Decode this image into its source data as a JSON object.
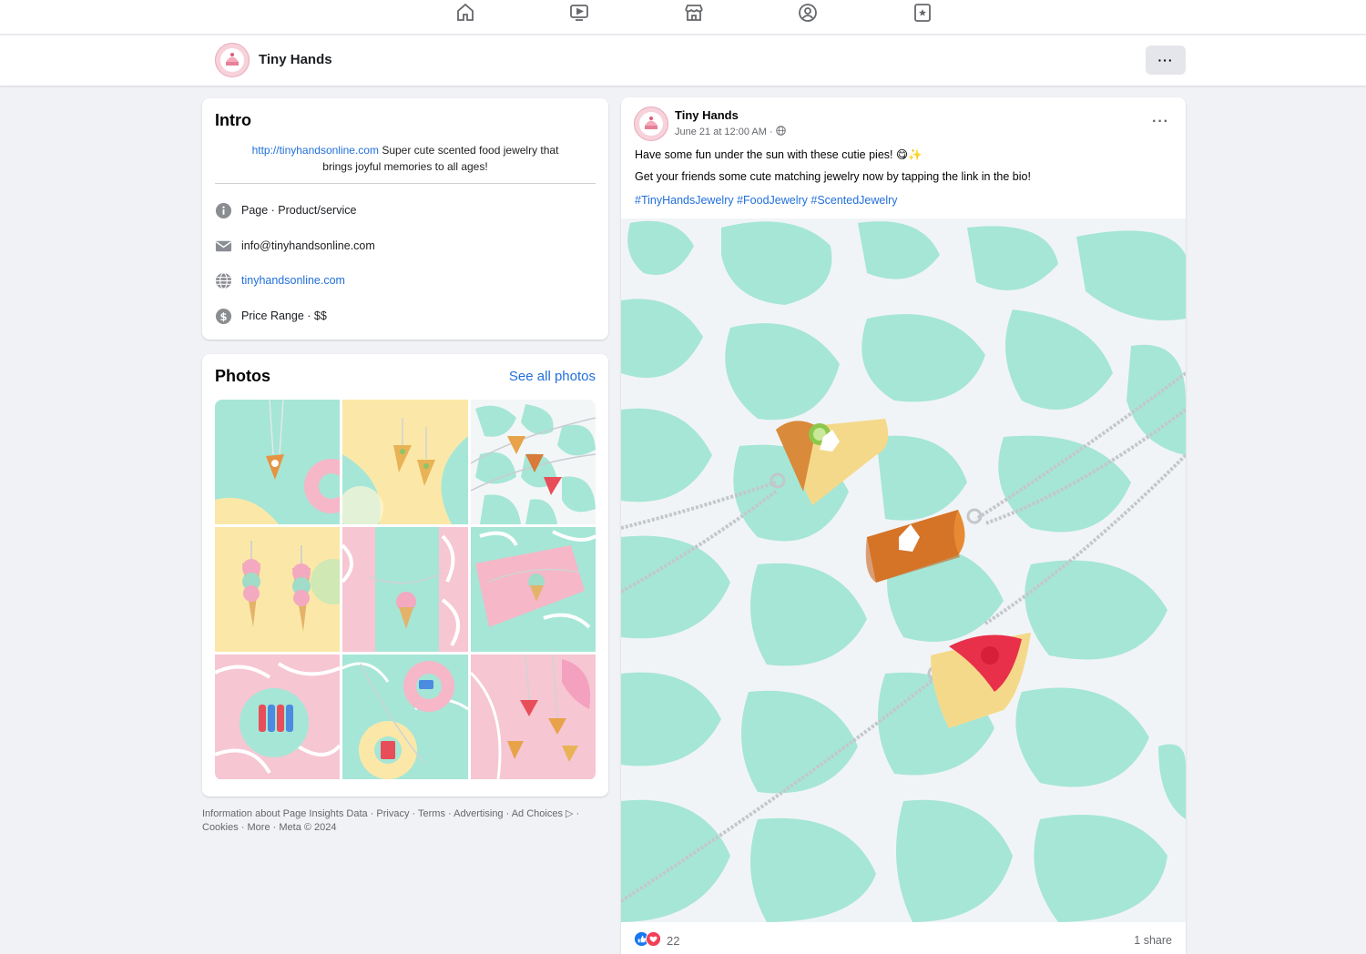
{
  "page_header": {
    "name": "Tiny Hands",
    "more_label": "···"
  },
  "intro": {
    "title": "Intro",
    "bio_link": "http://tinyhandsonline.com",
    "bio_text_line1": " Super cute scented food jewelry that",
    "bio_text_line2": "brings joyful memories to all ages!",
    "rows": [
      {
        "icon": "info-icon",
        "text": "Page · Product/service"
      },
      {
        "icon": "mail-icon",
        "text": "info@tinyhandsonline.com"
      },
      {
        "icon": "globe-icon",
        "text": "tinyhandsonline.com"
      },
      {
        "icon": "price-icon",
        "text": "Price Range · $$"
      }
    ]
  },
  "photos": {
    "title": "Photos",
    "see_all": "See all photos"
  },
  "footer": {
    "line1": "Information about Page Insights Data · Privacy · Terms · Advertising · Ad Choices ▷ ·",
    "line2": "Cookies · More · Meta © 2024"
  },
  "post": {
    "author": "Tiny Hands",
    "timestamp": "June 21 at 12:00 AM ·",
    "text_line1": "Have some fun under the sun with these cutie pies! 😋✨",
    "text_line2": "Get your friends some cute matching jewelry now by tapping the link in the bio!",
    "hashtags": "#TinyHandsJewelry #FoodJewelry #ScentedJewelry",
    "reaction_count": "22",
    "share_count": "1 share",
    "more_label": "···"
  },
  "colors": {
    "link": "#216fdb",
    "mint": "#a6e6d6",
    "pink": "#f6c6d3",
    "yellow": "#fbe8a8"
  }
}
